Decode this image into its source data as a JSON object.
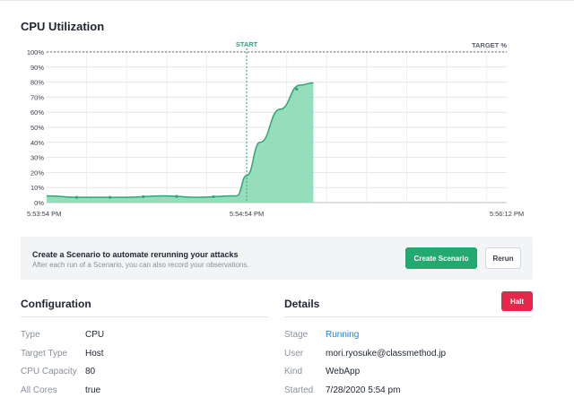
{
  "chart_section": {
    "title": "CPU Utilization"
  },
  "chart_data": {
    "type": "area",
    "title": "CPU Utilization",
    "ylim": [
      0,
      100
    ],
    "y_ticks": [
      "0%",
      "10%",
      "20%",
      "30%",
      "40%",
      "50%",
      "60%",
      "70%",
      "80%",
      "90%",
      "100%"
    ],
    "x_ticks": [
      "5:53:54 PM",
      "5:54:54 PM",
      "5:56:12 PM"
    ],
    "x_range_seconds": [
      0,
      138
    ],
    "x_tick_seconds": [
      0,
      60,
      138
    ],
    "start_marker": {
      "label": "START",
      "second": 60
    },
    "target_line": {
      "label": "TARGET %",
      "value": 100
    },
    "series": [
      {
        "x_seconds": [
          0,
          9,
          24,
          35,
          45,
          57,
          60,
          64,
          70,
          76,
          80
        ],
        "values": [
          4.5,
          3.5,
          3.5,
          4.5,
          3.5,
          4.5,
          18,
          40,
          62,
          78,
          79.5
        ],
        "markers_at_seconds": [
          9,
          19,
          29,
          39,
          50,
          75
        ]
      }
    ],
    "colors": {
      "line": "#2aa876",
      "fill": "#8ad9b4",
      "grid": "#e2e5e9"
    }
  },
  "banner": {
    "title": "Create a Scenario to automate rerunning your attacks",
    "subtitle": "After each run of a Scenario, you can also record your observations.",
    "create_label": "Create Scenario",
    "rerun_label": "Rerun"
  },
  "configuration": {
    "title": "Configuration",
    "rows": [
      {
        "key": "Type",
        "value": "CPU"
      },
      {
        "key": "Target Type",
        "value": "Host"
      },
      {
        "key": "CPU Capacity",
        "value": "80"
      },
      {
        "key": "All Cores",
        "value": "true"
      }
    ]
  },
  "details": {
    "title": "Details",
    "halt_label": "Halt",
    "rows": [
      {
        "key": "Stage",
        "value": "Running"
      },
      {
        "key": "User",
        "value": "mori.ryosuke@classmethod.jp"
      },
      {
        "key": "Kind",
        "value": "WebApp"
      },
      {
        "key": "Started",
        "value": "7/28/2020 5:54 pm"
      }
    ]
  },
  "colors": {
    "primary": "#23a870",
    "danger": "#e3284c",
    "link": "#1d7fd1"
  }
}
